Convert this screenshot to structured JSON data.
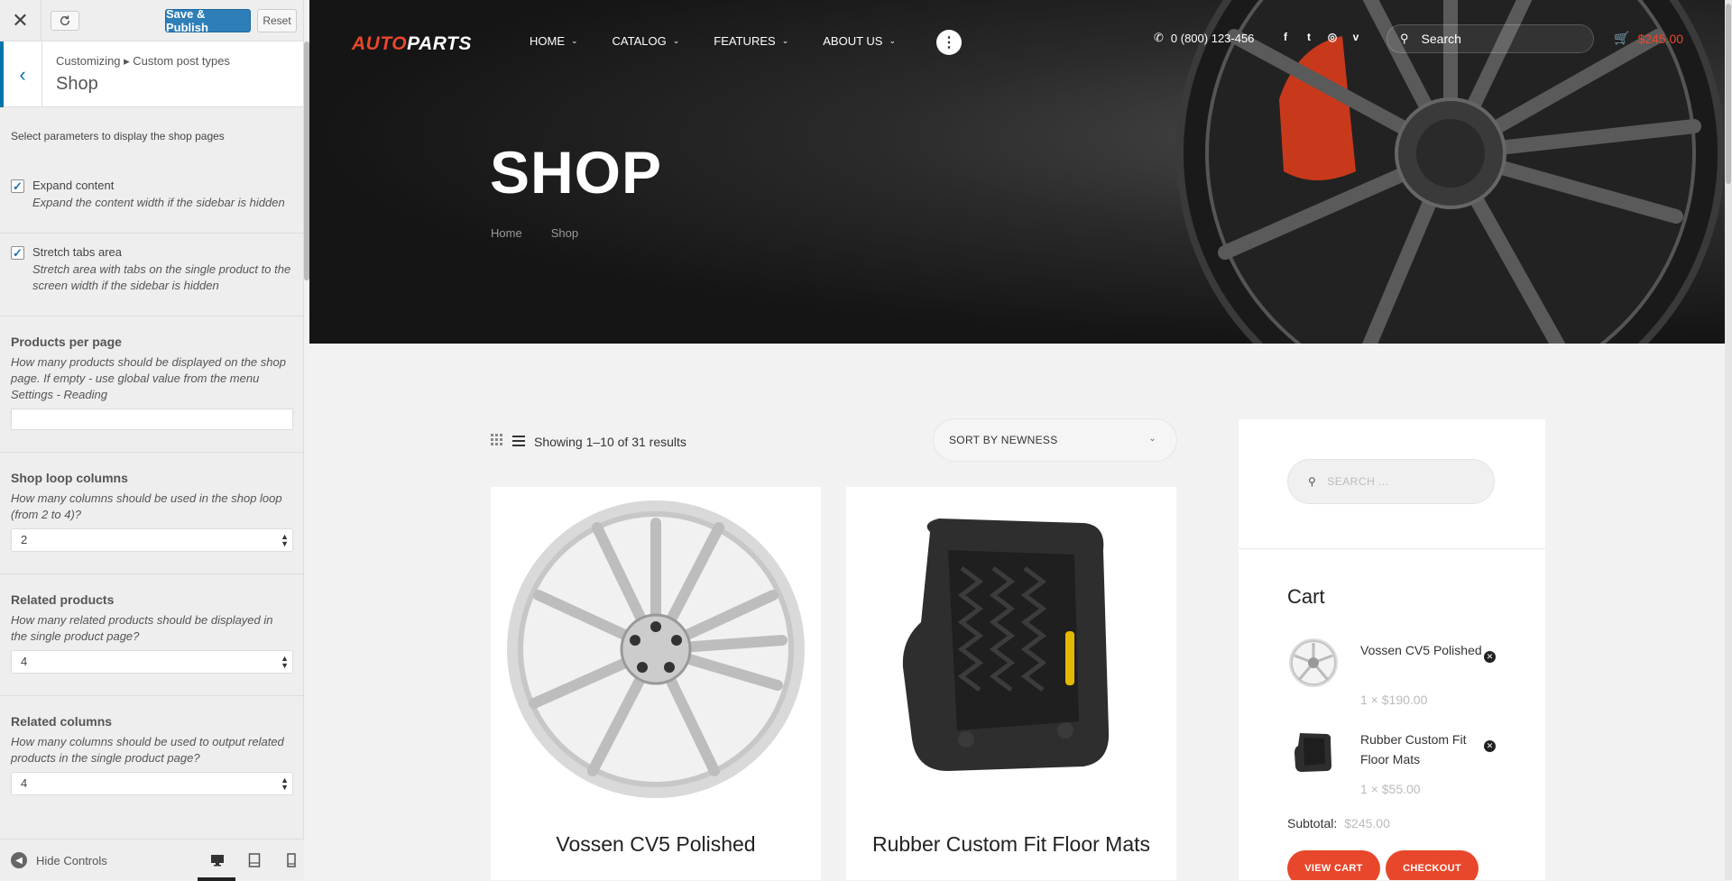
{
  "customizer": {
    "close_icon": "close-icon",
    "save_label": "Save & Publish",
    "reset_label": "Reset",
    "breadcrumb": "Customizing ▸ Custom post types",
    "section_title": "Shop",
    "intro": "Select parameters to display the shop pages",
    "expand_content": {
      "label": "Expand content",
      "checked": true,
      "desc": "Expand the content width if the sidebar is hidden"
    },
    "stretch_tabs": {
      "label": "Stretch tabs area",
      "checked": true,
      "desc": "Stretch area with tabs on the single product to the screen width if the sidebar is hidden"
    },
    "products_per_page": {
      "title": "Products per page",
      "desc": "How many products should be displayed on the shop page. If empty - use global value from the menu Settings - Reading",
      "value": ""
    },
    "shop_loop_columns": {
      "title": "Shop loop columns",
      "desc": "How many columns should be used in the shop loop (from 2 to 4)?",
      "value": "2"
    },
    "related_products": {
      "title": "Related products",
      "desc": "How many related products should be displayed in the single product page?",
      "value": "4"
    },
    "related_columns": {
      "title": "Related columns",
      "desc": "How many columns should be used to output related products in the single product page?",
      "value": "4"
    },
    "hide_controls": "Hide Controls",
    "accent": "#0073aa"
  },
  "site": {
    "logo_part1": "AUTO",
    "logo_part2": "PARTS",
    "nav": [
      "HOME",
      "CATALOG",
      "FEATURES",
      "ABOUT US"
    ],
    "phone": "0 (800) 123-456",
    "search_placeholder": "Search",
    "cart_total": "$245.00",
    "accent": "#e8472b"
  },
  "hero": {
    "title": "SHOP",
    "breadcrumb": [
      "Home",
      "Shop"
    ]
  },
  "shop": {
    "results": "Showing 1–10 of 31 results",
    "sort": "SORT BY NEWNESS",
    "products": [
      {
        "name": "Vossen CV5 Polished"
      },
      {
        "name": "Rubber Custom Fit Floor Mats"
      }
    ]
  },
  "widgets": {
    "search_placeholder": "SEARCH ...",
    "cart_title": "Cart",
    "items": [
      {
        "name": "Vossen CV5 Polished",
        "qty": "1 ×",
        "price": "$190.00"
      },
      {
        "name": "Rubber Custom Fit Floor Mats",
        "qty": "1 ×",
        "price": "$55.00"
      }
    ],
    "subtotal_label": "Subtotal:",
    "subtotal_value": "$245.00",
    "view_cart": "VIEW CART",
    "checkout": "CHECKOUT"
  }
}
